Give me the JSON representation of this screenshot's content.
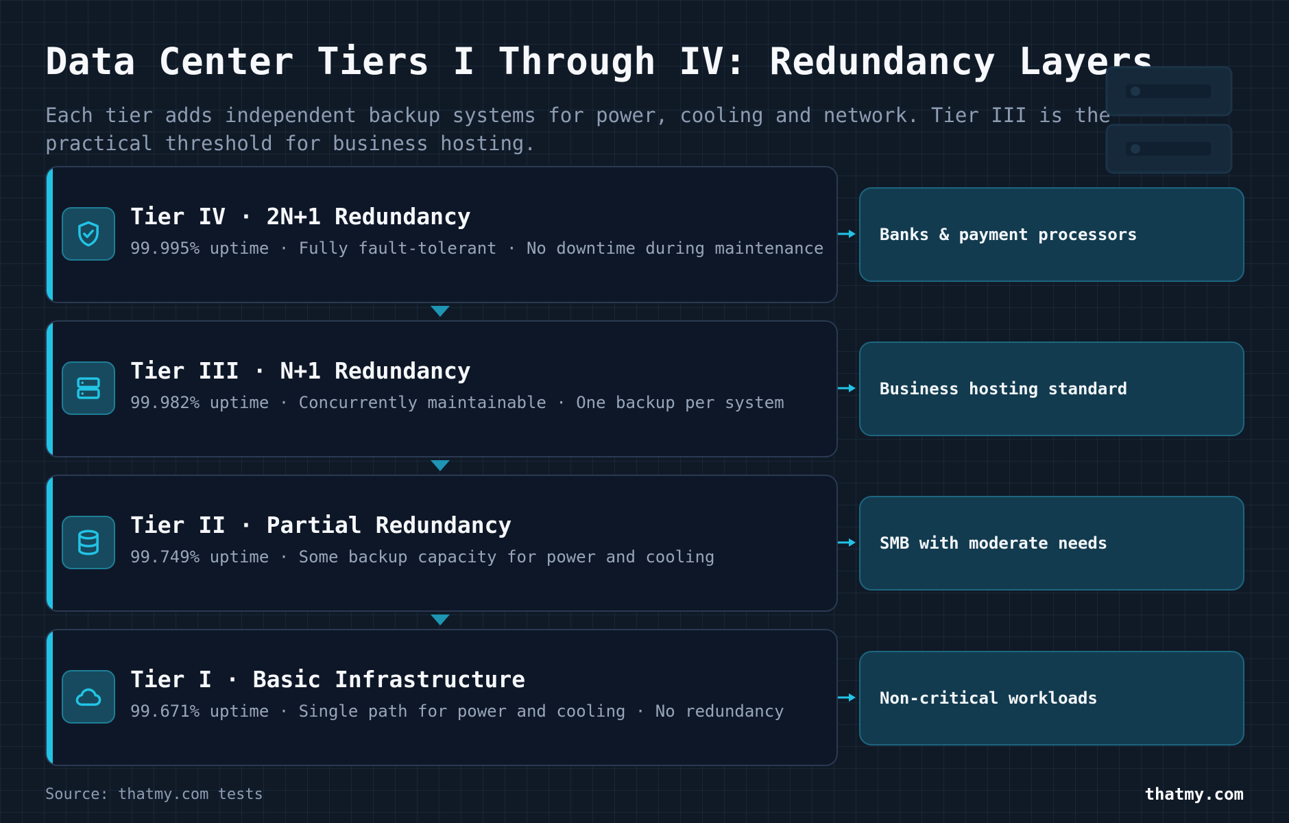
{
  "title": "Data Center Tiers I Through IV: Redundancy Layers",
  "subtitle": "Each tier adds independent backup systems for power, cooling and network. Tier III is the practical threshold for business hosting.",
  "accent_color": "#22c4e6",
  "tiers": [
    {
      "name": "Tier IV · 2N+1 Redundancy",
      "detail": "99.995% uptime · Fully fault-tolerant · No downtime during maintenance",
      "icon": "shield-check-icon",
      "use_case": "Banks & payment processors"
    },
    {
      "name": "Tier III · N+1 Redundancy",
      "detail": "99.982% uptime · Concurrently maintainable · One backup per system",
      "icon": "server-icon",
      "use_case": "Business hosting standard"
    },
    {
      "name": "Tier II · Partial Redundancy",
      "detail": "99.749% uptime · Some backup capacity for power and cooling",
      "icon": "database-icon",
      "use_case": "SMB with moderate needs"
    },
    {
      "name": "Tier I · Basic Infrastructure",
      "detail": "99.671% uptime · Single path for power and cooling · No redundancy",
      "icon": "cloud-icon",
      "use_case": "Non-critical workloads"
    }
  ],
  "footer": {
    "source": "Source: thatmy.com tests",
    "brand": "thatmy.com"
  }
}
